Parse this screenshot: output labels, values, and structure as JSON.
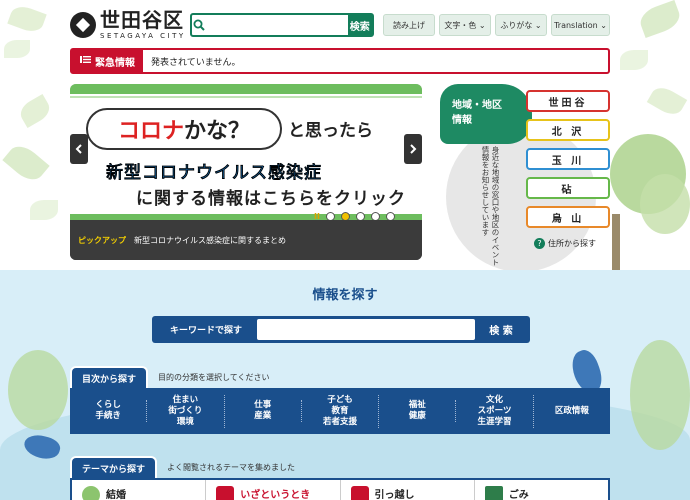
{
  "header": {
    "logo_ja": "世田谷区",
    "logo_en": "SETAGAYA CITY",
    "search_placeholder": "",
    "search_button": "検索",
    "utility": [
      {
        "label": "読み上げ"
      },
      {
        "label": "文字・色 ⌄"
      },
      {
        "label": "ふりがな ⌄"
      },
      {
        "label": "Translation ⌄"
      }
    ]
  },
  "emergency": {
    "label": "緊急情報",
    "text": "発表されていません。"
  },
  "banner": {
    "line1_red": "コロナ",
    "line1_rest": "かな？",
    "line2": "と思ったら",
    "line3": "新型コロナウイルス感染症",
    "line4": "に関する情報はこちらをクリック",
    "pause_label": "II",
    "pickup_label": "ピックアップ",
    "pickup_text": "新型コロナウイルス感染症に関するまとめ",
    "slide_count": 5,
    "active_slide": 2
  },
  "area_info": {
    "title_line1": "地域・地区",
    "title_line2": "情報",
    "description": "身近な地域の窓口や地区のイベント情報をお知らせしています",
    "districts": [
      {
        "label": "世田谷",
        "color": "#d6332f"
      },
      {
        "label": "北 沢",
        "color": "#e7c31a"
      },
      {
        "label": "玉 川",
        "color": "#2f8fd2"
      },
      {
        "label": "砧",
        "color": "#66b84a"
      },
      {
        "label": "烏 山",
        "color": "#e8892a"
      }
    ],
    "address_link": "住所から探す"
  },
  "find": {
    "title": "情報を探す",
    "keyword_label": "キーワードで探す",
    "keyword_button": "検 索",
    "category_tab": "目次から探す",
    "category_desc": "目的の分類を選択してください",
    "categories": [
      "くらし\n手続き",
      "住まい\n街づくり\n環境",
      "仕事\n産業",
      "子ども\n教育\n若者支援",
      "福祉\n健康",
      "文化\nスポーツ\n生涯学習",
      "区政情報"
    ],
    "theme_tab": "テーマから探す",
    "theme_desc": "よく閲覧されるテーマを集めました",
    "themes": [
      {
        "label": "結婚",
        "style": "normal"
      },
      {
        "label": "いざというとき",
        "style": "red"
      },
      {
        "label": "引っ越し",
        "style": "normal"
      },
      {
        "label": "ごみ",
        "style": "normal"
      }
    ]
  },
  "colors": {
    "brand_green": "#137d5a",
    "emergency_red": "#c8102e",
    "navy": "#1a4f8c",
    "light_blue_bg": "#d8eef8"
  }
}
